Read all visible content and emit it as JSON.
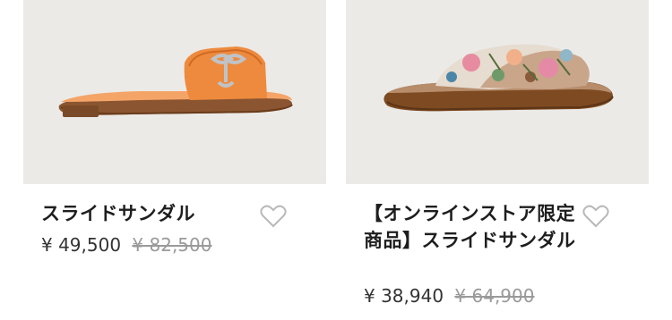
{
  "products": [
    {
      "title": "スライドサンダル",
      "price": "¥ 49,500",
      "original_price": "¥ 82,500",
      "image_color": "#ee8a3e"
    },
    {
      "title": "【オンラインストア限定商品】スライドサンダル",
      "price": "¥ 38,940",
      "original_price": "¥ 64,900",
      "image_color": "#c59e88"
    }
  ],
  "icons": {
    "favorite": "heart-outline-icon"
  },
  "colors": {
    "image_background": "#ebeae7",
    "strike_price": "#9a9a9a"
  }
}
